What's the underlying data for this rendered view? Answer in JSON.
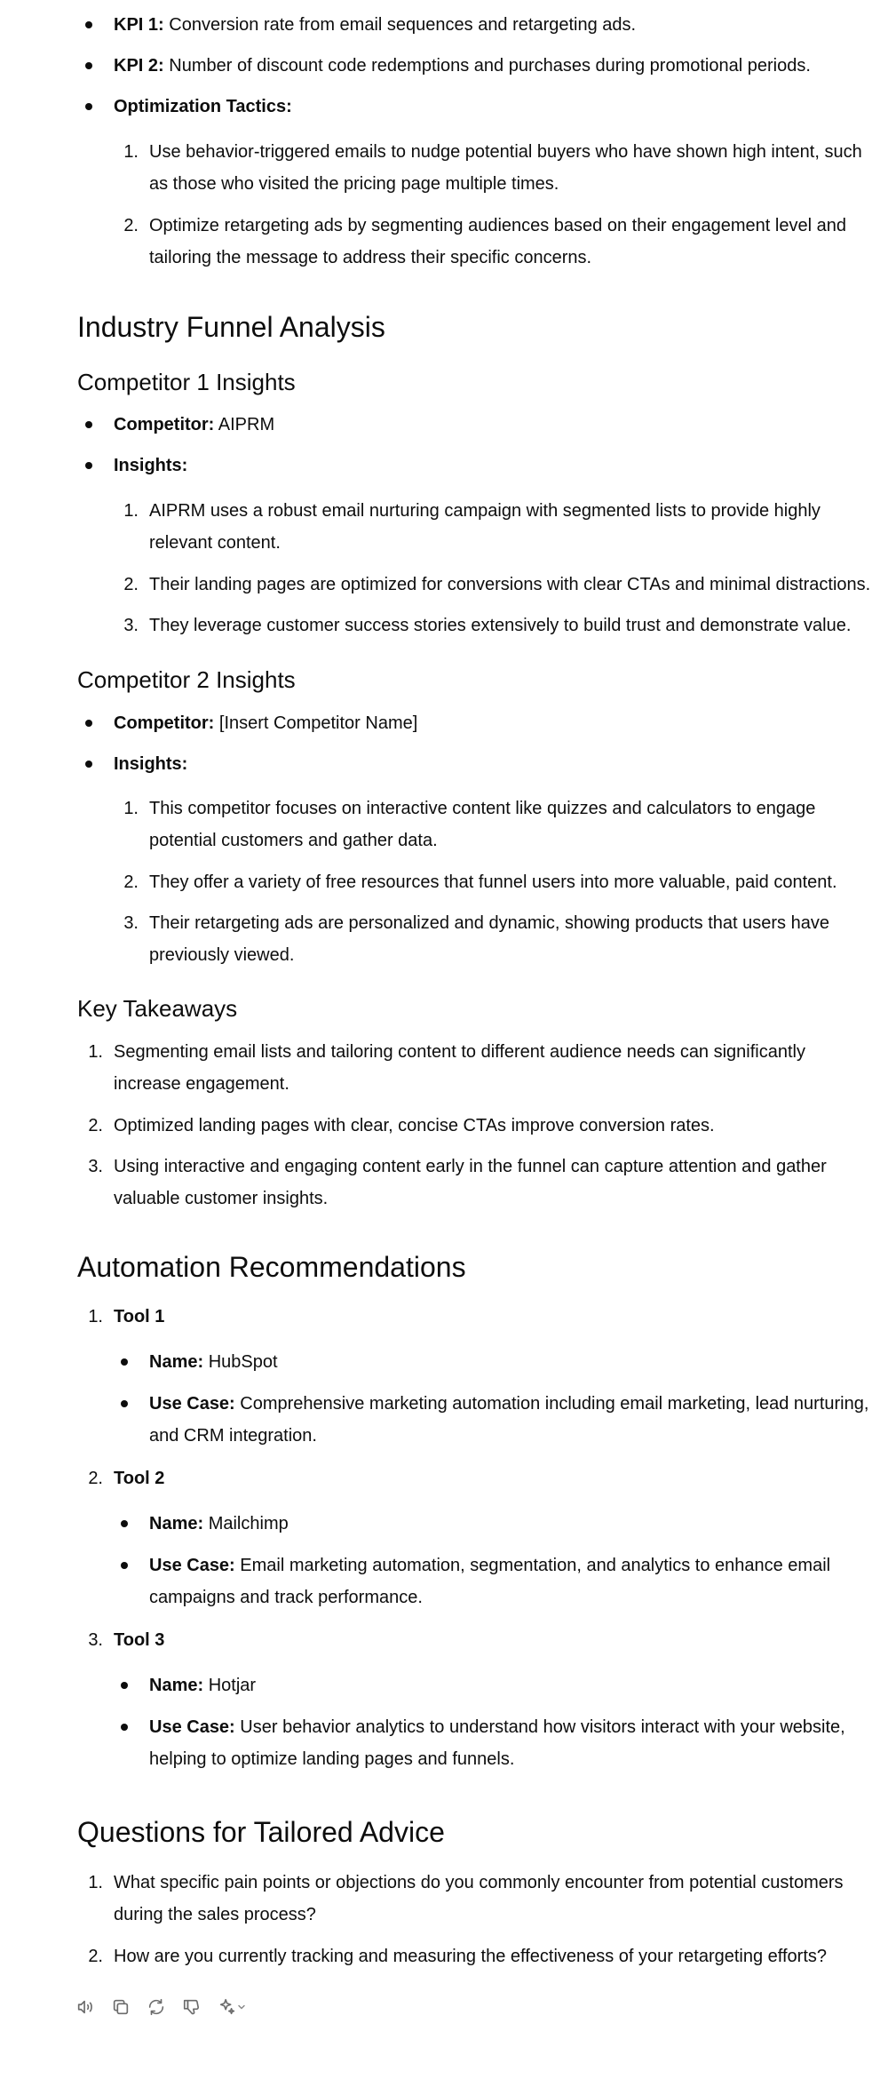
{
  "kpis": [
    {
      "label": "KPI 1:",
      "text": "Conversion rate from email sequences and retargeting ads."
    },
    {
      "label": "KPI 2:",
      "text": "Number of discount code redemptions and purchases during promotional periods."
    }
  ],
  "tactics": {
    "label": "Optimization Tactics:",
    "items": [
      {
        "n": "1.",
        "lines": [
          "Use behavior-triggered emails to nudge potential buyers who have shown high intent, such",
          "as those who visited the pricing page multiple times."
        ]
      },
      {
        "n": "2.",
        "lines": [
          "Optimize retargeting ads by segmenting audiences based on their engagement level and",
          "tailoring the message to address their specific concerns."
        ]
      }
    ]
  },
  "industry": {
    "title": "Industry Funnel Analysis",
    "c1": {
      "title": "Competitor 1 Insights",
      "competitor_label": "Competitor:",
      "competitor_value": "AIPRM",
      "insights_label": "Insights:",
      "items": [
        {
          "n": "1.",
          "lines": [
            "AIPRM uses a robust email nurturing campaign with segmented lists to provide highly",
            "relevant content."
          ]
        },
        {
          "n": "2.",
          "lines": [
            "Their landing pages are optimized for conversions with clear CTAs and minimal distractions."
          ]
        },
        {
          "n": "3.",
          "lines": [
            "They leverage customer success stories extensively to build trust and demonstrate value."
          ]
        }
      ]
    },
    "c2": {
      "title": "Competitor 2 Insights",
      "competitor_label": "Competitor:",
      "competitor_value": "[Insert Competitor Name]",
      "insights_label": "Insights:",
      "items": [
        {
          "n": "1.",
          "lines": [
            "This competitor focuses on interactive content like quizzes and calculators to engage",
            "potential customers and gather data."
          ]
        },
        {
          "n": "2.",
          "lines": [
            "They offer a variety of free resources that funnel users into more valuable, paid content."
          ]
        },
        {
          "n": "3.",
          "lines": [
            "Their retargeting ads are personalized and dynamic, showing products that users have",
            "previously viewed."
          ]
        }
      ]
    },
    "takeaways": {
      "title": "Key Takeaways",
      "items": [
        {
          "n": "1.",
          "lines": [
            "Segmenting email lists and tailoring content to different audience needs can significantly",
            "increase engagement."
          ]
        },
        {
          "n": "2.",
          "lines": [
            "Optimized landing pages with clear, concise CTAs improve conversion rates."
          ]
        },
        {
          "n": "3.",
          "lines": [
            "Using interactive and engaging content early in the funnel can capture attention and gather",
            "valuable customer insights."
          ]
        }
      ]
    }
  },
  "automation": {
    "title": "Automation Recommendations",
    "name_label": "Name:",
    "usecase_label": "Use Case:",
    "tools": [
      {
        "n": "1.",
        "title": "Tool 1",
        "name": "HubSpot",
        "usecase_lines": [
          "Comprehensive marketing automation including email marketing, lead nurturing,",
          "and CRM integration."
        ]
      },
      {
        "n": "2.",
        "title": "Tool 2",
        "name": "Mailchimp",
        "usecase_lines": [
          "Email marketing automation, segmentation, and analytics to enhance email",
          "campaigns and track performance."
        ]
      },
      {
        "n": "3.",
        "title": "Tool 3",
        "name": "Hotjar",
        "usecase_lines": [
          "User behavior analytics to understand how visitors interact with your website,",
          "helping to optimize landing pages and funnels."
        ]
      }
    ]
  },
  "questions": {
    "title": "Questions for Tailored Advice",
    "items": [
      {
        "n": "1.",
        "lines": [
          "What specific pain points or objections do you commonly encounter from potential customers",
          "during the sales process?"
        ]
      },
      {
        "n": "2.",
        "lines": [
          "How are you currently tracking and measuring the effectiveness of your retargeting efforts?"
        ]
      }
    ]
  },
  "toolbar": {
    "icons": [
      "speaker-icon",
      "copy-icon",
      "regenerate-icon",
      "thumbs-down-icon",
      "sparkle-model-icon"
    ]
  }
}
